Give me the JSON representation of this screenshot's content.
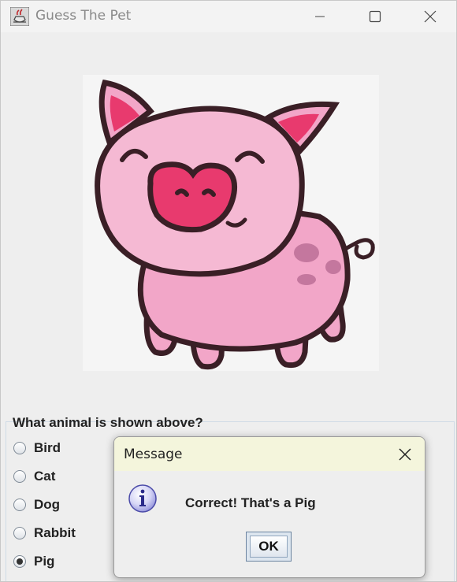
{
  "window": {
    "title": "Guess The Pet",
    "icon": "java-cup-icon",
    "controls": [
      "minimize-icon",
      "maximize-icon",
      "close-icon"
    ]
  },
  "content": {
    "image_subject": "pig-cartoon",
    "question": "What animal is shown above?",
    "options": [
      {
        "label": "Bird",
        "selected": false
      },
      {
        "label": "Cat",
        "selected": false
      },
      {
        "label": "Dog",
        "selected": false
      },
      {
        "label": "Rabbit",
        "selected": false
      },
      {
        "label": "Pig",
        "selected": true
      }
    ]
  },
  "dialog": {
    "title": "Message",
    "icon": "info-icon",
    "message": "Correct! That's a Pig",
    "ok_label": "OK"
  },
  "colors": {
    "pig_body": "#f2a6c8",
    "pig_snout": "#e83a6e",
    "dialog_titlebar": "#f4f5dc"
  }
}
